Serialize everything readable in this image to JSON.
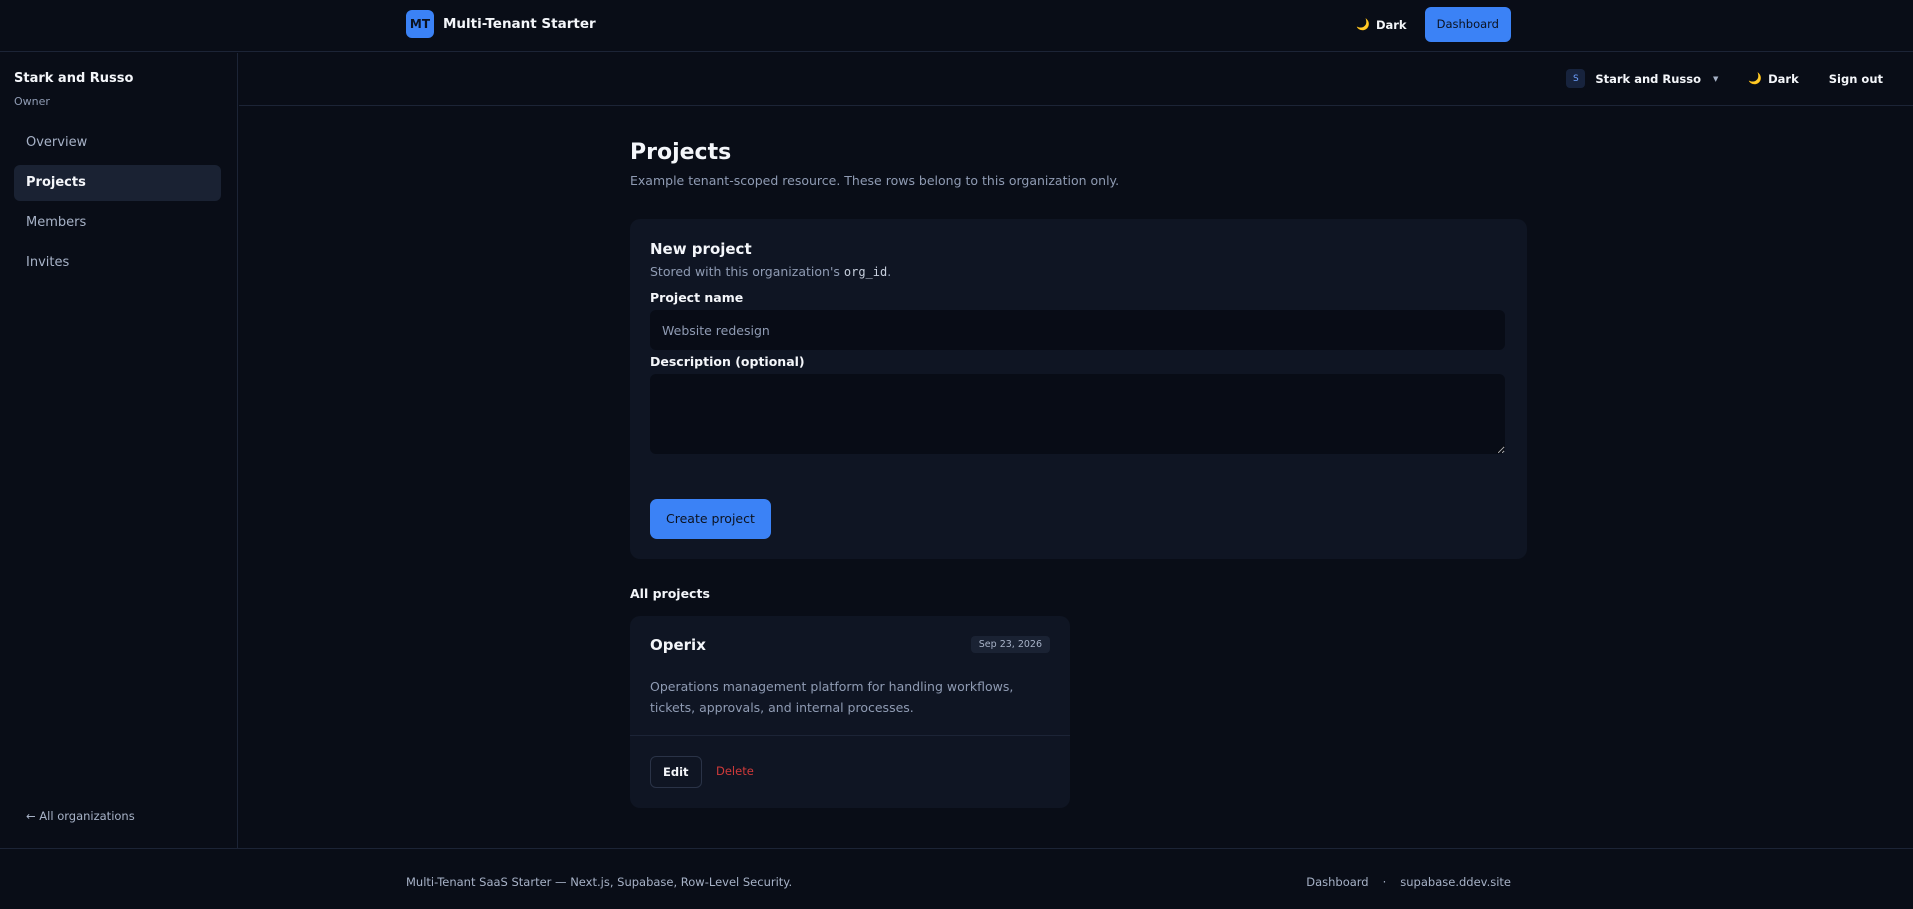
{
  "header": {
    "logo_initials": "MT",
    "brand": "Multi-Tenant Starter",
    "theme_label": "Dark",
    "dashboard_label": "Dashboard"
  },
  "sidebar": {
    "org_name": "Stark and Russo",
    "role": "Owner",
    "items": [
      {
        "label": "Overview"
      },
      {
        "label": "Projects"
      },
      {
        "label": "Members"
      },
      {
        "label": "Invites"
      }
    ],
    "active_item": "Projects",
    "back_label": "← All organizations"
  },
  "subbar": {
    "org_initial": "S",
    "org_name": "Stark and Russo",
    "theme_label": "Dark",
    "signout_label": "Sign out"
  },
  "main": {
    "title": "Projects",
    "subtitle": "Example tenant-scoped resource. These rows belong to this organization only.",
    "new_project": {
      "title": "New project",
      "subtitle_prefix": "Stored with this organization's ",
      "subtitle_code": "org_id",
      "subtitle_suffix": ".",
      "name_label": "Project name",
      "name_placeholder": "Website redesign",
      "description_label": "Description (optional)",
      "create_label": "Create project"
    },
    "all_projects_label": "All projects",
    "projects": [
      {
        "name": "Operix",
        "date": "Sep 23, 2026",
        "description": "Operations management platform for handling workflows, tickets, approvals, and internal processes.",
        "edit_label": "Edit",
        "delete_label": "Delete"
      }
    ]
  },
  "footer": {
    "left": "Multi-Tenant SaaS Starter — Next.js, Supabase, Row-Level Security.",
    "links": [
      "Dashboard",
      "supabase.ddev.site"
    ],
    "separator": "·"
  },
  "colors": {
    "background": "#090d17",
    "card": "#0f1523",
    "accent": "#3b82f6",
    "danger": "#d03a3a"
  }
}
